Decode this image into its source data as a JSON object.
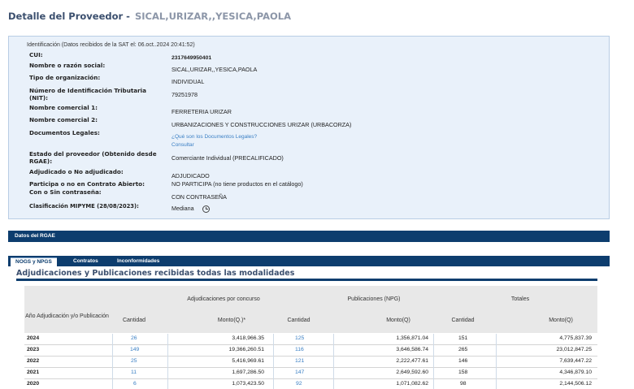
{
  "page": {
    "title": "Detalle del Proveedor -",
    "provider_name": "SICAL,URIZAR,,YESICA,PAOLA"
  },
  "info": {
    "header": "Identificación (Datos recibidos de la SAT el: 06.oct..2024 20:41:52)",
    "fields": {
      "cui": {
        "label": "CUI:",
        "value": "2317649950401"
      },
      "razon_social": {
        "label": "Nombre o razón social:",
        "value": "SICAL,URIZAR,,YESICA,PAOLA"
      },
      "tipo_org": {
        "label": "Tipo de organización:",
        "value": "INDIVIDUAL"
      },
      "nit": {
        "label": "Número de Identificación Tributaria (NIT):",
        "value": "79251978"
      },
      "nombre_com1": {
        "label": "Nombre comercial 1:",
        "value": "FERRETERIA URIZAR"
      },
      "nombre_com2": {
        "label": "Nombre comercial 2:",
        "value": "URBANIZACIONES Y CONSTRUCCIONES URIZAR (URBACORZA)"
      },
      "documentos": {
        "label": "Documentos Legales:",
        "link1": "¿Qué son los Documentos Legales?",
        "link2": "Consultar"
      },
      "estado": {
        "label": "Estado del proveedor (Obtenido desde RGAE):",
        "value": "Comerciante Individual (PRECALIFICADO)"
      },
      "adjudicado": {
        "label": "Adjudicado o No adjudicado:",
        "value": "ADJUDICADO"
      },
      "contrato_abierto": {
        "label": "Participa o no en Contrato Abierto:",
        "value": "NO PARTICIPA (no tiene productos en el catálogo)"
      },
      "contrasena": {
        "label": "Con o Sin contraseña:",
        "value": "CON CONTRASEÑA"
      },
      "mipyme": {
        "label": "Clasificación MIPYME (28/08/2023):",
        "value": "Mediana",
        "icon": "clock-icon"
      }
    }
  },
  "rgae": {
    "label": "Datos del RGAE"
  },
  "tabs": [
    {
      "label": "NOGS y NPGS",
      "active": true
    },
    {
      "label": "Contratos",
      "active": false
    },
    {
      "label": "Inconformidades",
      "active": false
    }
  ],
  "section": {
    "title": "Adjudicaciones y Publicaciones recibidas todas las modalidades"
  },
  "table": {
    "group_headers": {
      "adjudicaciones": "Adjudicaciones por concurso",
      "publicaciones": "Publicaciones (NPG)",
      "totales": "Totales"
    },
    "columns": {
      "year": "Año Adjudicación y/o Publicación",
      "cantidad_adj": "Cantidad",
      "monto_adj": "Monto(Q.)*",
      "cantidad_pub": "Cantidad",
      "monto_pub": "Monto(Q)",
      "cantidad_tot": "Cantidad",
      "monto_tot": "Monto(Q)"
    },
    "rows": [
      {
        "year": "2024",
        "adj_cant": "26",
        "adj_monto": "3,418,966.35",
        "pub_cant": "125",
        "pub_monto": "1,356,871.04",
        "tot_cant": "151",
        "tot_monto": "4,775,837.39"
      },
      {
        "year": "2023",
        "adj_cant": "149",
        "adj_monto": "19,366,260.51",
        "pub_cant": "116",
        "pub_monto": "3,646,586.74",
        "tot_cant": "265",
        "tot_monto": "23,012,847.25"
      },
      {
        "year": "2022",
        "adj_cant": "25",
        "adj_monto": "5,416,969.61",
        "pub_cant": "121",
        "pub_monto": "2,222,477.61",
        "tot_cant": "146",
        "tot_monto": "7,639,447.22"
      },
      {
        "year": "2021",
        "adj_cant": "11",
        "adj_monto": "1,697,286.50",
        "pub_cant": "147",
        "pub_monto": "2,649,592.60",
        "tot_cant": "158",
        "tot_monto": "4,346,879.10"
      },
      {
        "year": "2020",
        "adj_cant": "6",
        "adj_monto": "1,073,423.50",
        "pub_cant": "92",
        "pub_monto": "1,071,082.62",
        "tot_cant": "98",
        "tot_monto": "2,144,506.12"
      }
    ]
  }
}
